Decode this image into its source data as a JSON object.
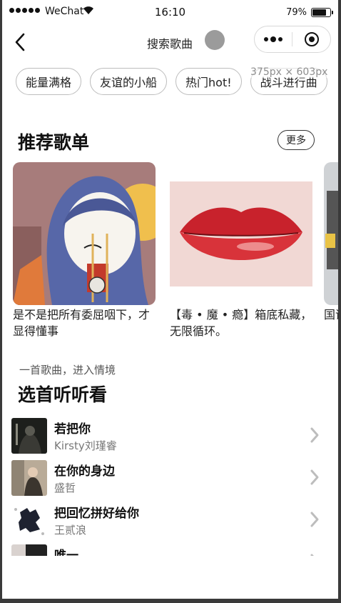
{
  "status_bar": {
    "carrier": "WeChat",
    "time": "16:10",
    "battery_text": "79%",
    "battery_level": 0.79
  },
  "nav": {
    "title": "搜索歌曲",
    "icons": {
      "back": "chevron-left-icon",
      "more": "more-dots-icon",
      "close": "target-circle-icon"
    }
  },
  "tags": [
    "能量满格",
    "友谊的小船",
    "热门hot!",
    "战斗进行曲"
  ],
  "viewport_label": "375px × 603px",
  "playlists": {
    "heading": "推荐歌单",
    "more_label": "更多",
    "items": [
      {
        "caption": "是不是把所有委屈咽下，才显得懂事"
      },
      {
        "caption": "【毒 • 魔 • 瘾】箱底私藏，无限循环。"
      },
      {
        "caption": "国语也是"
      }
    ]
  },
  "songs_section": {
    "subtitle": "一首歌曲，进入情境",
    "heading": "选首听听看",
    "songs": [
      {
        "name": "若把你",
        "artist": "Kirsty刘瑾睿"
      },
      {
        "name": "在你的身边",
        "artist": "盛哲"
      },
      {
        "name": "把回忆拼好给你",
        "artist": "王贰浪"
      },
      {
        "name": "唯一",
        "artist": ""
      }
    ]
  }
}
